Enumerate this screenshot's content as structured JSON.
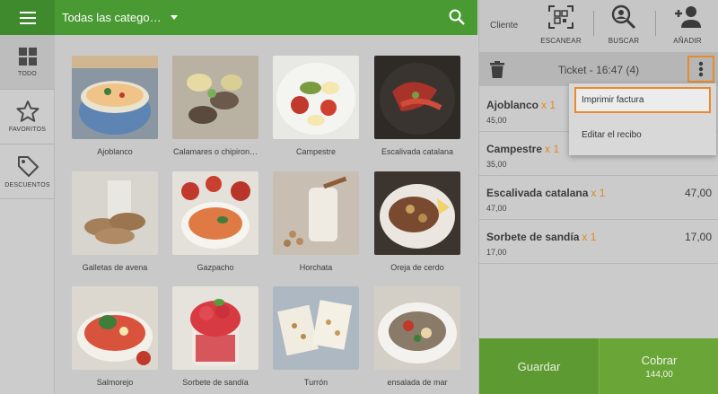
{
  "rail": {
    "items": [
      {
        "label": "TODO",
        "icon": "grid-icon",
        "active": true
      },
      {
        "label": "FAVORITOS",
        "icon": "star-icon",
        "active": false
      },
      {
        "label": "DESCUENTOS",
        "icon": "tag-icon",
        "active": false
      }
    ]
  },
  "topbar": {
    "category": "Todas las catego…"
  },
  "products": [
    {
      "name": "Ajoblanco"
    },
    {
      "name": "Calamares o chipiron…"
    },
    {
      "name": "Campestre"
    },
    {
      "name": "Escalivada catalana"
    },
    {
      "name": "Galletas de avena"
    },
    {
      "name": "Gazpacho"
    },
    {
      "name": "Horchata"
    },
    {
      "name": "Oreja de cerdo"
    },
    {
      "name": "Salmorejo"
    },
    {
      "name": "Sorbete de sandía"
    },
    {
      "name": "Turrón"
    },
    {
      "name": "ensalada de mar"
    }
  ],
  "right": {
    "cliente": "Cliente",
    "tools": [
      {
        "label": "ESCANEAR",
        "icon": "qr-scan-icon"
      },
      {
        "label": "BUSCAR",
        "icon": "person-search-icon"
      },
      {
        "label": "AÑADIR",
        "icon": "add-person-icon"
      }
    ],
    "ticket_title": "Ticket - 16:47 (4)",
    "lines": [
      {
        "name": "Ajoblanco",
        "qty": "x 1",
        "unit": "45,00",
        "total": ""
      },
      {
        "name": "Campestre",
        "qty": "x 1",
        "unit": "35,00",
        "total": ""
      },
      {
        "name": "Escalivada catalana",
        "qty": "x 1",
        "unit": "47,00",
        "total": "47,00"
      },
      {
        "name": "Sorbete de sandía",
        "qty": "x 1",
        "unit": "17,00",
        "total": "17,00"
      }
    ],
    "guardar": "Guardar",
    "cobrar": "Cobrar",
    "cobrar_amount": "144,00"
  },
  "menu": {
    "items": [
      "Imprimir factura",
      "Editar el recibo"
    ]
  },
  "colors": {
    "brand_green": "#4a9a34",
    "highlight_orange": "#e98a2c",
    "qty_orange": "#e08a1e"
  }
}
